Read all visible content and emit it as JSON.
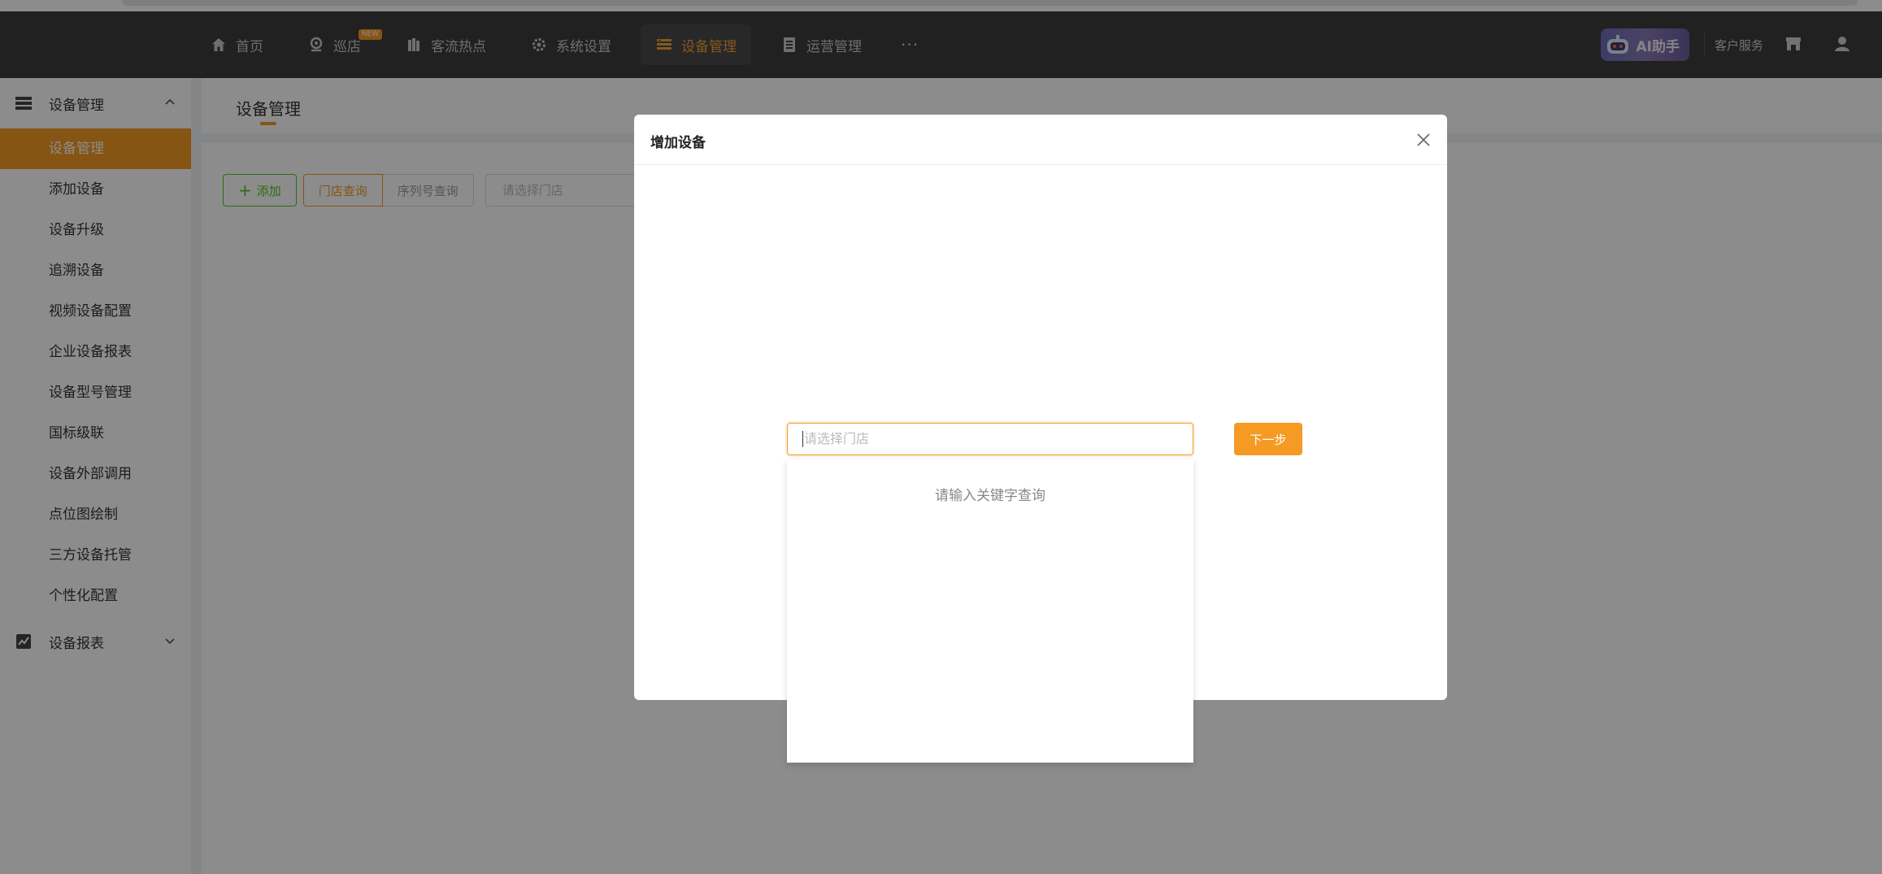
{
  "header": {
    "nav": [
      {
        "label": "首页",
        "icon": "home-icon"
      },
      {
        "label": "巡店",
        "icon": "location-pin-icon",
        "badge": "NEW"
      },
      {
        "label": "客流热点",
        "icon": "crowd-icon"
      },
      {
        "label": "系统设置",
        "icon": "settings-icon"
      },
      {
        "label": "设备管理",
        "icon": "device-icon",
        "active": true
      },
      {
        "label": "运营管理",
        "icon": "document-icon"
      }
    ],
    "more": "···",
    "ai_label": "AI助手",
    "customer_service": "客户服务"
  },
  "sidebar": {
    "group1": "设备管理",
    "items": [
      "设备管理",
      "添加设备",
      "设备升级",
      "追溯设备",
      "视频设备配置",
      "企业设备报表",
      "设备型号管理",
      "国标级联",
      "设备外部调用",
      "点位图绘制",
      "三方设备托管",
      "个性化配置"
    ],
    "group2": "设备报表"
  },
  "main": {
    "title": "设备管理",
    "add_label": "添加",
    "seg_store": "门店查询",
    "seg_serial": "序列号查询",
    "store_placeholder": "请选择门店"
  },
  "modal": {
    "title": "增加设备",
    "select_placeholder": "请选择门店",
    "next_label": "下一步",
    "dropdown_empty": "请输入关键字查询"
  },
  "colors": {
    "accent": "#f59a23",
    "header_bg": "#3d3d3d",
    "add_green": "#52c41a"
  }
}
